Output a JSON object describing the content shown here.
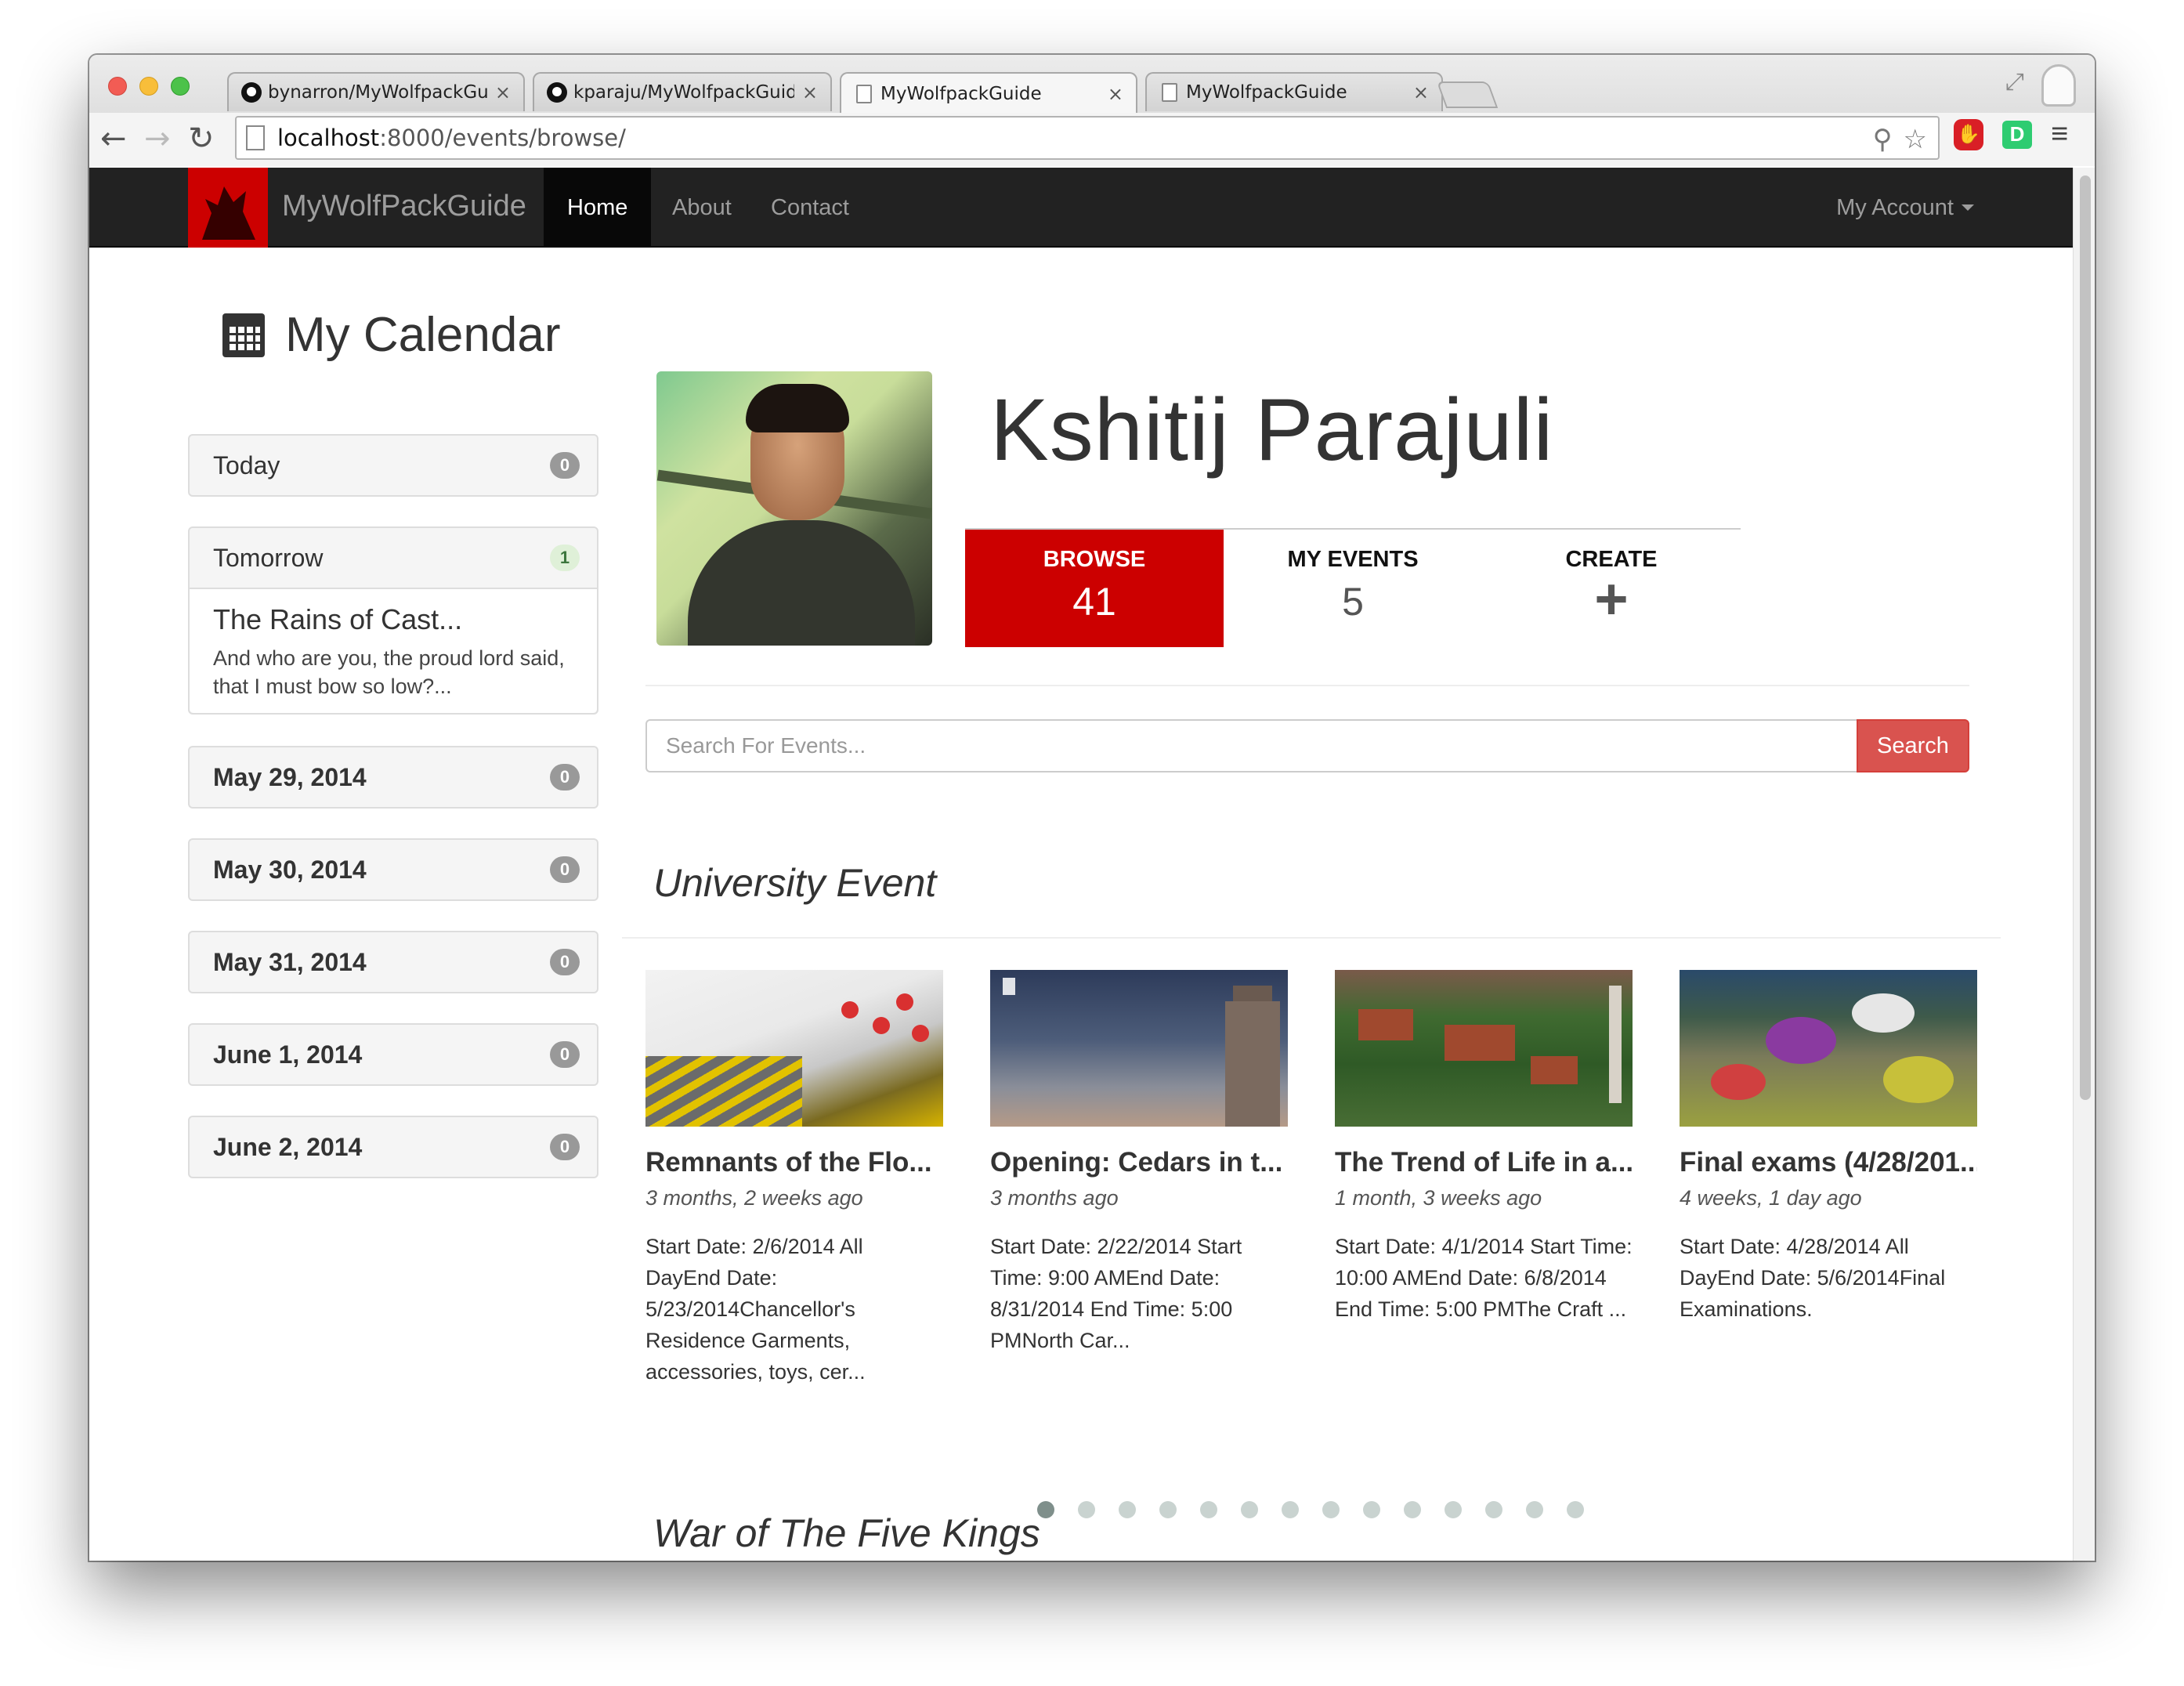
{
  "browser": {
    "tabs": [
      {
        "title": "bynarron/MyWolfpackGuid",
        "icon": "github-icon",
        "active": false
      },
      {
        "title": "kparaju/MyWolfpackGuide",
        "icon": "github-icon",
        "active": false
      },
      {
        "title": "MyWolfpackGuide",
        "icon": "page-icon",
        "active": true
      },
      {
        "title": "MyWolfpackGuide",
        "icon": "page-icon",
        "active": false
      }
    ],
    "tab_close": "×",
    "url_host": "localhost",
    "url_rest": ":8000/events/browse/"
  },
  "navbar": {
    "brand": "MyWolfPackGuide",
    "items": [
      "Home",
      "About",
      "Contact"
    ],
    "active_item": "Home",
    "account": "My Account"
  },
  "sidebar": {
    "title": "My Calendar",
    "days": [
      {
        "label": "Today",
        "count": "0",
        "bold": false
      },
      {
        "label": "Tomorrow",
        "count": "1",
        "bold": false,
        "event": {
          "title": "The Rains of Cast...",
          "snippet": "And who are you, the proud lord said, that I must bow so low?..."
        }
      },
      {
        "label": "May 29, 2014",
        "count": "0",
        "bold": true
      },
      {
        "label": "May 30, 2014",
        "count": "0",
        "bold": true
      },
      {
        "label": "May 31, 2014",
        "count": "0",
        "bold": true
      },
      {
        "label": "June 1, 2014",
        "count": "0",
        "bold": true
      },
      {
        "label": "June 2, 2014",
        "count": "0",
        "bold": true
      }
    ]
  },
  "profile": {
    "name": "Kshitij Parajuli",
    "stats": [
      {
        "label": "BROWSE",
        "value": "41"
      },
      {
        "label": "MY EVENTS",
        "value": "5"
      },
      {
        "label": "CREATE",
        "value": "+"
      }
    ]
  },
  "search": {
    "placeholder": "Search For Events...",
    "button": "Search"
  },
  "sections": [
    {
      "title": "University Event",
      "cards": [
        {
          "title": "Remnants of the Flo...",
          "ago": "3 months, 2 weeks ago",
          "desc": "Start Date: 2/6/2014 All DayEnd Date: 5/23/2014Chancellor's Residence Garments, accessories, toys, cer..."
        },
        {
          "title": "Opening: Cedars in t...",
          "ago": "3 months ago",
          "desc": "Start Date: 2/22/2014 Start Time: 9:00 AMEnd Date: 8/31/2014 End Time: 5:00 PMNorth Car..."
        },
        {
          "title": "The Trend of Life in a...",
          "ago": "1 month, 3 weeks ago",
          "desc": "Start Date: 4/1/2014 Start Time: 10:00 AMEnd Date: 6/8/2014 End Time: 5:00 PMThe Craft ..."
        },
        {
          "title": "Final exams (4/28/201...",
          "ago": "4 weeks, 1 day ago",
          "desc": "Start Date: 4/28/2014 All DayEnd Date: 5/6/2014Final Examinations."
        }
      ],
      "carousel": {
        "pages": 14,
        "active": 0
      }
    },
    {
      "title": "War of The Five Kings"
    }
  ],
  "colors": {
    "brand_red": "#cc0000",
    "navbar": "#222222",
    "search_button": "#d9534f"
  }
}
